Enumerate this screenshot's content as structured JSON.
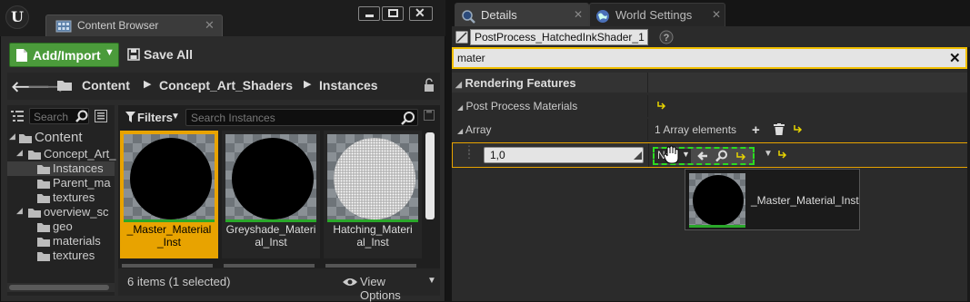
{
  "content_browser": {
    "tab_title": "Content Browser",
    "toolbar": {
      "add_import": "Add/Import",
      "save_all": "Save All"
    },
    "breadcrumb": [
      "Content",
      "Concept_Art_Shaders",
      "Instances"
    ],
    "sources": {
      "search_placeholder": "Search",
      "tree": [
        {
          "label": "Content",
          "expanded": true,
          "level": 0
        },
        {
          "label": "Concept_Art_",
          "expanded": true,
          "level": 1
        },
        {
          "label": "Instances",
          "selected": true,
          "level": 2
        },
        {
          "label": "Parent_ma",
          "level": 2
        },
        {
          "label": "textures",
          "level": 2
        },
        {
          "label": "overview_sc",
          "expanded": true,
          "level": 1
        },
        {
          "label": "geo",
          "level": 2
        },
        {
          "label": "materials",
          "level": 2
        },
        {
          "label": "textures",
          "level": 2
        }
      ]
    },
    "filters_label": "Filters",
    "asset_search_placeholder": "Search Instances",
    "assets": [
      {
        "label": "_Master_Material_Inst",
        "selected": true,
        "preview": "black-sphere"
      },
      {
        "label": "Greyshade_Material_Inst",
        "selected": false,
        "preview": "black-sphere"
      },
      {
        "label": "Hatching_Material_Inst",
        "selected": false,
        "preview": "hatched-sphere"
      }
    ],
    "status": "6 items (1 selected)",
    "view_options": "View Options"
  },
  "details": {
    "tabs": [
      {
        "label": "Details",
        "icon": "magnifier-icon",
        "active": true
      },
      {
        "label": "World Settings",
        "icon": "globe-icon",
        "active": false
      }
    ],
    "object_name": "PostProcess_HatchedInkShader_1",
    "search_value": "mater",
    "category": "Rendering Features",
    "rows": {
      "post_process_materials": "Post Process Materials",
      "array_label": "Array",
      "array_count": "1 Array elements"
    },
    "element": {
      "index": "1,0",
      "value": "No"
    },
    "drag_tooltip": "_Master_Material_Inst"
  },
  "colors": {
    "accent_orange": "#e8a300",
    "add_button_green": "#4b9b3b",
    "drop_target_green": "#2bdc1f",
    "search_highlight": "#f2c000",
    "reset_arrow_yellow": "#e8d400"
  }
}
